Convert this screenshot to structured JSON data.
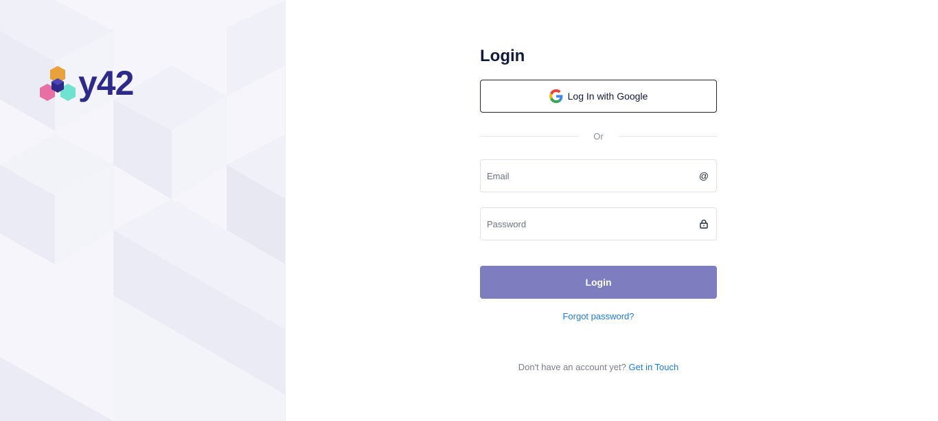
{
  "brand": {
    "name": "y42",
    "colors": {
      "orange": "#e9a13b",
      "pink": "#e86fa3",
      "teal": "#6fe3d0",
      "navy": "#2d2a8c"
    }
  },
  "login": {
    "title": "Login",
    "google_button_label": "Log In with Google",
    "divider_text": "Or",
    "email_placeholder": "Email",
    "email_icon": "at-icon",
    "password_placeholder": "Password",
    "password_icon": "lock-icon",
    "submit_label": "Login",
    "forgot_password": "Forgot password?",
    "signup_prompt": "Don't have an account yet?",
    "signup_link": "Get in Touch"
  },
  "colors": {
    "accent_button": "#7d7dbf",
    "link": "#1f7ae0",
    "title": "#111a3a"
  }
}
